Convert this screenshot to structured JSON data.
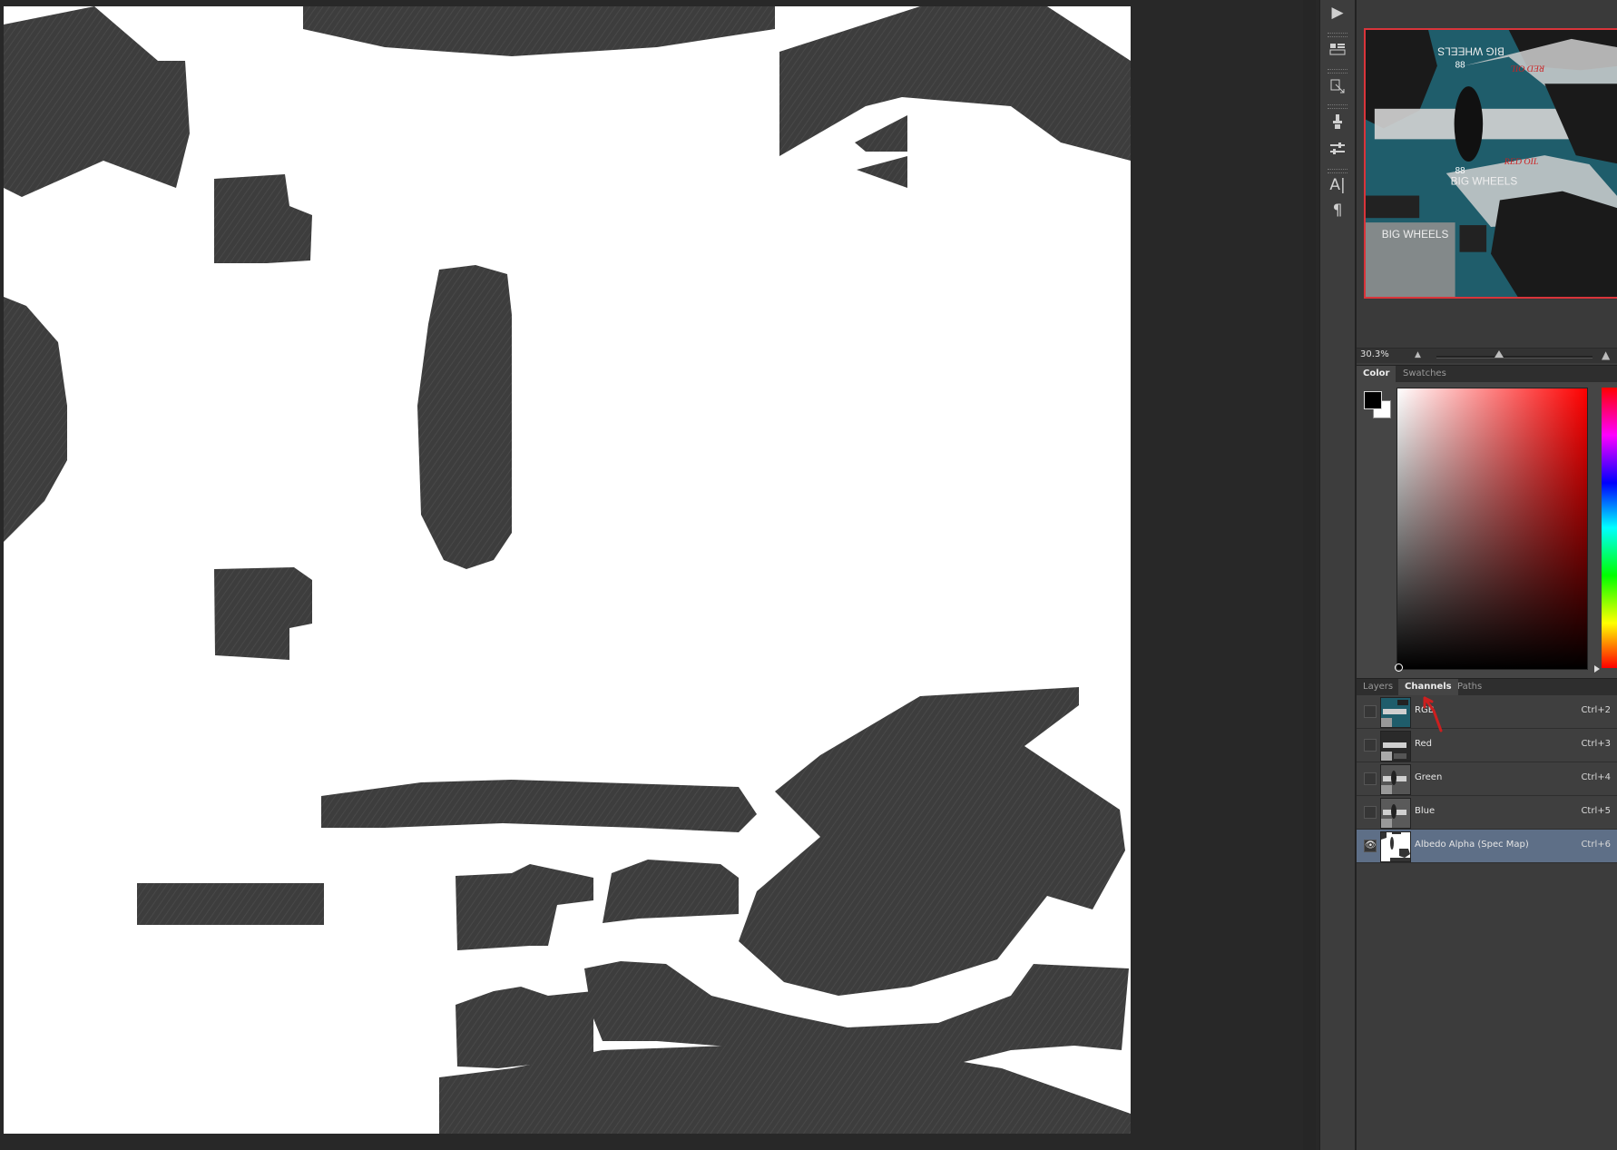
{
  "navigator": {
    "zoom_level": "30.3%",
    "thumbnail_texts": [
      "BIG WHEELS",
      "RED OIL",
      "88",
      "BIG WHEELS",
      "RED OIL",
      "88",
      "BIG WHEELS"
    ],
    "zoom_slider_fraction": 0.4
  },
  "color_tabs": [
    {
      "label": "Color",
      "active": true
    },
    {
      "label": "Swatches",
      "active": false
    }
  ],
  "colors": {
    "foreground": "#000000",
    "background": "#ffffff",
    "hue": "#ff0000",
    "selection": "#5e6f87",
    "canvas_shape": "#3d3d3d"
  },
  "layer_tabs": [
    {
      "label": "Layers",
      "active": false
    },
    {
      "label": "Channels",
      "active": true
    },
    {
      "label": "Paths",
      "active": false
    }
  ],
  "channels": [
    {
      "name": "RGB",
      "shortcut": "Ctrl+2",
      "visible": false,
      "selected": false
    },
    {
      "name": "Red",
      "shortcut": "Ctrl+3",
      "visible": false,
      "selected": false
    },
    {
      "name": "Green",
      "shortcut": "Ctrl+4",
      "visible": false,
      "selected": false
    },
    {
      "name": "Blue",
      "shortcut": "Ctrl+5",
      "visible": false,
      "selected": false
    },
    {
      "name": "Albedo Alpha (Spec Map)",
      "shortcut": "Ctrl+6",
      "visible": true,
      "selected": true
    }
  ],
  "icons": {
    "strip": [
      "play-icon",
      "history-icon",
      "clone-source-icon",
      "brush-presets-icon",
      "brush-settings-icon",
      "character-icon",
      "paragraph-icon"
    ],
    "visibility": "eye-icon"
  }
}
